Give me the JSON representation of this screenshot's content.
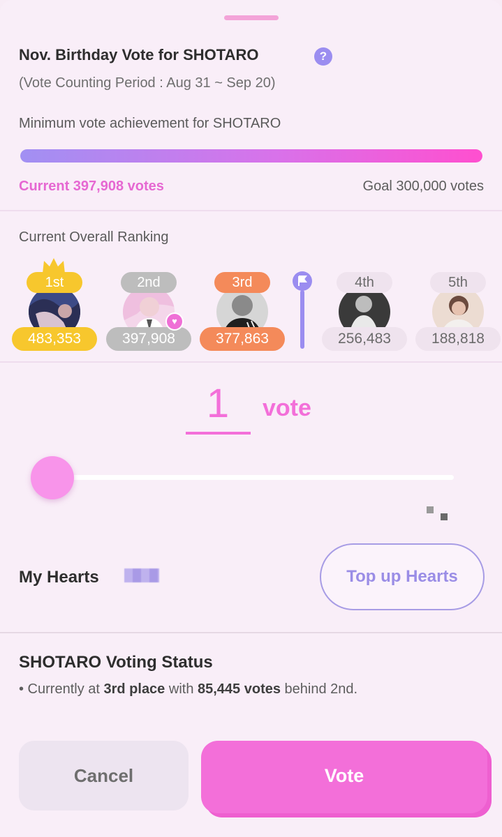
{
  "header": {
    "title": "Nov. Birthday Vote for SHOTARO",
    "help_icon": "?",
    "period": "(Vote Counting Period : Aug 31 ~ Sep 20)"
  },
  "achievement": {
    "label": "Minimum vote achievement for SHOTARO",
    "progress_fraction": 1.0,
    "current": "Current 397,908 votes",
    "goal": "Goal 300,000 votes"
  },
  "ranking": {
    "label": "Current Overall Ranking",
    "items": [
      {
        "rank": "1st",
        "votes": "483,353"
      },
      {
        "rank": "2nd",
        "votes": "397,908"
      },
      {
        "rank": "3rd",
        "votes": "377,863"
      },
      {
        "rank": "4th",
        "votes": "256,483"
      },
      {
        "rank": "5th",
        "votes": "188,818"
      }
    ]
  },
  "vote": {
    "count": "1",
    "unit": "vote",
    "slider_fraction": 0.0
  },
  "hearts": {
    "label": "My Hearts",
    "topup_label": "Top up Hearts"
  },
  "status": {
    "title": "SHOTARO Voting Status",
    "prefix": "• Currently at ",
    "place": "3rd place",
    "middle": " with ",
    "gap": "85,445 votes",
    "suffix": " behind 2nd."
  },
  "actions": {
    "cancel": "Cancel",
    "vote": "Vote"
  },
  "colors": {
    "accent": "#f36fd9",
    "purple": "#9b8df0",
    "gold": "#f7c72d",
    "silver": "#bdbdbd",
    "bronze": "#f48a5a"
  },
  "icons": [
    "grab-handle",
    "help-icon",
    "crown-icon",
    "heart-icon",
    "flag-icon"
  ]
}
